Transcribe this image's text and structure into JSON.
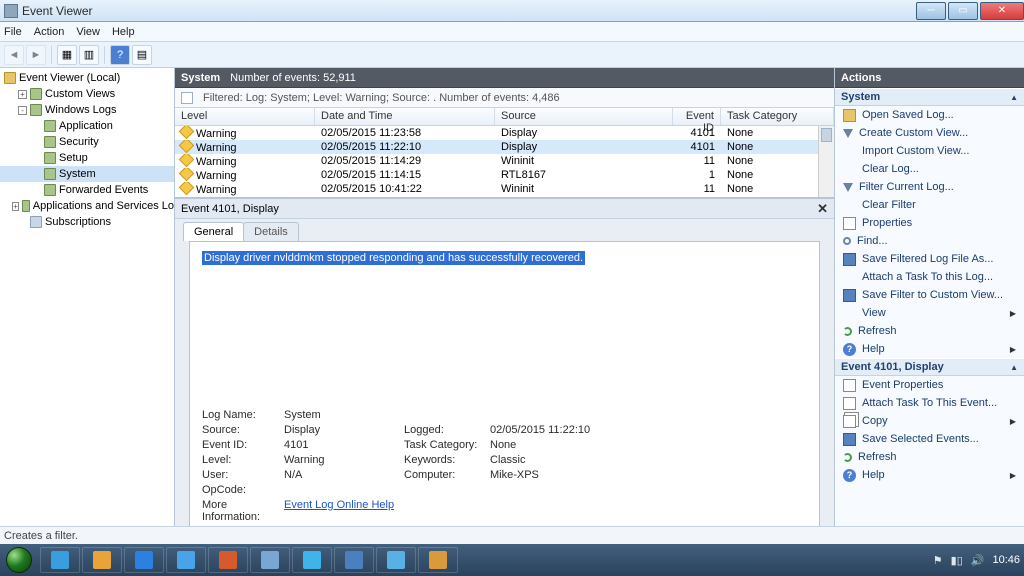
{
  "window": {
    "title": "Event Viewer"
  },
  "menu": [
    "File",
    "Action",
    "View",
    "Help"
  ],
  "tree": {
    "root": "Event Viewer (Local)",
    "items": [
      {
        "label": "Custom Views",
        "indent": 1,
        "expand": "+",
        "icon": "log"
      },
      {
        "label": "Windows Logs",
        "indent": 1,
        "expand": "-",
        "icon": "log"
      },
      {
        "label": "Application",
        "indent": 2,
        "icon": "log"
      },
      {
        "label": "Security",
        "indent": 2,
        "icon": "log"
      },
      {
        "label": "Setup",
        "indent": 2,
        "icon": "log"
      },
      {
        "label": "System",
        "indent": 2,
        "icon": "log",
        "selected": true
      },
      {
        "label": "Forwarded Events",
        "indent": 2,
        "icon": "log"
      },
      {
        "label": "Applications and Services Lo",
        "indent": 1,
        "expand": "+",
        "icon": "log"
      },
      {
        "label": "Subscriptions",
        "indent": 1,
        "icon": "sub"
      }
    ]
  },
  "center": {
    "name": "System",
    "count_label": "Number of events:",
    "count": "52,911",
    "filter_text": "Filtered: Log: System; Level: Warning; Source: . Number of events: 4,486",
    "columns": [
      "Level",
      "Date and Time",
      "Source",
      "Event ID",
      "Task Category"
    ],
    "rows": [
      {
        "level": "Warning",
        "dt": "02/05/2015 11:23:58",
        "src": "Display",
        "id": "4101",
        "cat": "None",
        "selected": false
      },
      {
        "level": "Warning",
        "dt": "02/05/2015 11:22:10",
        "src": "Display",
        "id": "4101",
        "cat": "None",
        "selected": true
      },
      {
        "level": "Warning",
        "dt": "02/05/2015 11:14:29",
        "src": "Wininit",
        "id": "11",
        "cat": "None",
        "selected": false
      },
      {
        "level": "Warning",
        "dt": "02/05/2015 11:14:15",
        "src": "RTL8167",
        "id": "1",
        "cat": "None",
        "selected": false
      },
      {
        "level": "Warning",
        "dt": "02/05/2015 10:41:22",
        "src": "Wininit",
        "id": "11",
        "cat": "None",
        "selected": false
      }
    ]
  },
  "preview": {
    "title": "Event 4101, Display",
    "tabs": [
      "General",
      "Details"
    ],
    "message": "Display driver nvlddmkm stopped responding and has successfully recovered.",
    "props": {
      "logname_l": "Log Name:",
      "logname": "System",
      "source_l": "Source:",
      "source": "Display",
      "logged_l": "Logged:",
      "logged": "02/05/2015 11:22:10",
      "eventid_l": "Event ID:",
      "eventid": "4101",
      "taskcat_l": "Task Category:",
      "taskcat": "None",
      "level_l": "Level:",
      "level": "Warning",
      "keywords_l": "Keywords:",
      "keywords": "Classic",
      "user_l": "User:",
      "user": "N/A",
      "computer_l": "Computer:",
      "computer": "Mike-XPS",
      "opcode_l": "OpCode:",
      "moreinfo_l": "More Information:",
      "moreinfo": "Event Log Online Help"
    }
  },
  "actions": {
    "header": "Actions",
    "section1": "System",
    "items1": [
      {
        "label": "Open Saved Log...",
        "icon": "open"
      },
      {
        "label": "Create Custom View...",
        "icon": "filter"
      },
      {
        "label": "Import Custom View...",
        "icon": ""
      },
      {
        "label": "Clear Log...",
        "icon": ""
      },
      {
        "label": "Filter Current Log...",
        "icon": "filter"
      },
      {
        "label": "Clear Filter",
        "icon": ""
      },
      {
        "label": "Properties",
        "icon": "prop"
      },
      {
        "label": "Find...",
        "icon": "find"
      },
      {
        "label": "Save Filtered Log File As...",
        "icon": "save"
      },
      {
        "label": "Attach a Task To this Log...",
        "icon": ""
      },
      {
        "label": "Save Filter to Custom View...",
        "icon": "save"
      },
      {
        "label": "View",
        "icon": "",
        "arrow": true
      },
      {
        "label": "Refresh",
        "icon": "refresh"
      },
      {
        "label": "Help",
        "icon": "help",
        "arrow": true
      }
    ],
    "section2": "Event 4101, Display",
    "items2": [
      {
        "label": "Event Properties",
        "icon": "prop"
      },
      {
        "label": "Attach Task To This Event...",
        "icon": "prop"
      },
      {
        "label": "Copy",
        "icon": "copy",
        "arrow": true
      },
      {
        "label": "Save Selected Events...",
        "icon": "save"
      },
      {
        "label": "Refresh",
        "icon": "refresh"
      },
      {
        "label": "Help",
        "icon": "help",
        "arrow": true
      }
    ]
  },
  "status": "Creates a filter.",
  "taskbar": {
    "icons": [
      "#3a9dde",
      "#e8a33a",
      "#2d7fe0",
      "#4aa3e8",
      "#d65a2e",
      "#7aa6d4",
      "#3fb4e8",
      "#4a7fc0",
      "#58b0e4",
      "#d89a3c"
    ],
    "time": "10:46"
  }
}
